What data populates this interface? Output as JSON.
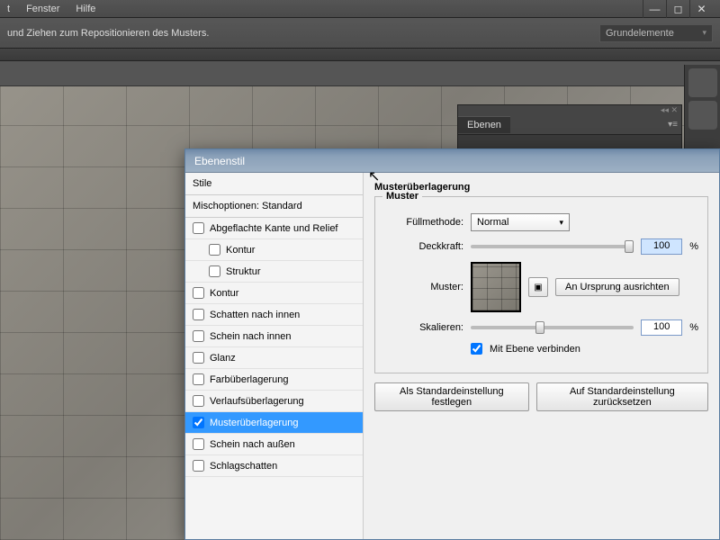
{
  "menu": {
    "items": [
      "t",
      "Fenster",
      "Hilfe"
    ]
  },
  "hint": "und Ziehen zum Repositionieren des Musters.",
  "toolbar": {
    "dropdown": "Grundelemente"
  },
  "panels": {
    "layers_tab": "Ebenen"
  },
  "dialog": {
    "title": "Ebenenstil",
    "styles_header": "Stile",
    "mix_options": "Mischoptionen: Standard",
    "items": [
      {
        "label": "Abgeflachte Kante und Relief",
        "checked": false,
        "sub": false
      },
      {
        "label": "Kontur",
        "checked": false,
        "sub": true
      },
      {
        "label": "Struktur",
        "checked": false,
        "sub": true
      },
      {
        "label": "Kontur",
        "checked": false,
        "sub": false
      },
      {
        "label": "Schatten nach innen",
        "checked": false,
        "sub": false
      },
      {
        "label": "Schein nach innen",
        "checked": false,
        "sub": false
      },
      {
        "label": "Glanz",
        "checked": false,
        "sub": false
      },
      {
        "label": "Farbüberlagerung",
        "checked": false,
        "sub": false
      },
      {
        "label": "Verlaufsüberlagerung",
        "checked": false,
        "sub": false
      },
      {
        "label": "Musterüberlagerung",
        "checked": true,
        "sub": false,
        "selected": true
      },
      {
        "label": "Schein nach außen",
        "checked": false,
        "sub": false
      },
      {
        "label": "Schlagschatten",
        "checked": false,
        "sub": false
      }
    ],
    "section_title": "Musterüberlagerung",
    "fieldset_legend": "Muster",
    "blend_label": "Füllmethode:",
    "blend_value": "Normal",
    "opacity_label": "Deckkraft:",
    "opacity_value": "100",
    "pct": "%",
    "pattern_label": "Muster:",
    "snap_origin": "An Ursprung ausrichten",
    "scale_label": "Skalieren:",
    "scale_value": "100",
    "link_layer": "Mit Ebene verbinden",
    "make_default": "Als Standardeinstellung festlegen",
    "reset_default": "Auf Standardeinstellung zurücksetzen"
  }
}
